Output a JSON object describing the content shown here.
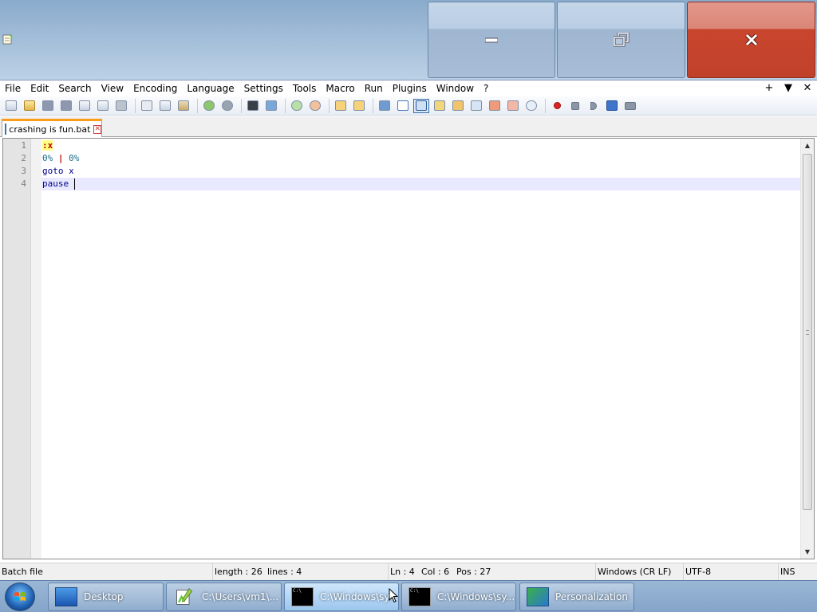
{
  "window": {
    "caption_buttons": {
      "minimize": "—",
      "restore": "⧉",
      "close": "✕"
    }
  },
  "menu": {
    "items": [
      "File",
      "Edit",
      "Search",
      "View",
      "Encoding",
      "Language",
      "Settings",
      "Tools",
      "Macro",
      "Run",
      "Plugins",
      "Window",
      "?"
    ],
    "right_controls": [
      "+",
      "▼",
      "✕"
    ]
  },
  "toolbar": {
    "icons": [
      "new-file-icon",
      "open-file-icon",
      "save-icon",
      "save-all-icon",
      "close-icon",
      "close-all-icon",
      "print-icon",
      "cut-icon",
      "copy-icon",
      "paste-icon",
      "undo-icon",
      "redo-icon",
      "find-icon",
      "replace-icon",
      "zoom-in-icon",
      "zoom-out-icon",
      "sync-vertical-icon",
      "sync-horizontal-icon",
      "word-wrap-icon",
      "show-all-characters-icon",
      "indent-guide-icon",
      "user-defined-language-icon",
      "document-map-icon",
      "function-list-icon",
      "folder-as-workspace-icon",
      "document-list-icon",
      "monitoring-icon",
      "record-macro-icon",
      "stop-recording-icon",
      "playback-icon",
      "run-macro-multiple-icon",
      "save-macro-icon"
    ]
  },
  "tab": {
    "label": "crashing is fun.bat",
    "close": "✕"
  },
  "editor": {
    "line_numbers": [
      "1",
      "2",
      "3",
      "4"
    ],
    "lines": [
      {
        "text": ":x"
      },
      {
        "part1": "0%",
        "part2": " ",
        "op": "|",
        "part3": " ",
        "part4": "0%"
      },
      {
        "text": "goto x"
      },
      {
        "text": "pause"
      }
    ],
    "current_line": 4
  },
  "scrollbar": {
    "up": "▲",
    "down": "▼"
  },
  "status": {
    "file_type": "Batch file",
    "length": "length : 26",
    "lines": "lines : 4",
    "ln": "Ln : 4",
    "col": "Col : 6",
    "pos": "Pos : 27",
    "eol": "Windows (CR LF)",
    "encoding": "UTF-8",
    "mode": "INS"
  },
  "taskbar": {
    "items": [
      {
        "label": "Desktop",
        "icon": "desktop-icon"
      },
      {
        "label": "C:\\Users\\vm1\\...",
        "icon": "notepad-plus-plus-icon"
      },
      {
        "label": "C:\\Windows\\sy...",
        "icon": "cmd-icon"
      },
      {
        "label": "C:\\Windows\\sy...",
        "icon": "cmd-icon"
      },
      {
        "label": "Personalization",
        "icon": "personalization-icon"
      }
    ],
    "active_index": 2
  },
  "colors": {
    "close_red": "#c9452e",
    "tab_accent": "#fa9c1a",
    "label_highlight": "#ffff80",
    "current_line": "#e8e8ff"
  }
}
